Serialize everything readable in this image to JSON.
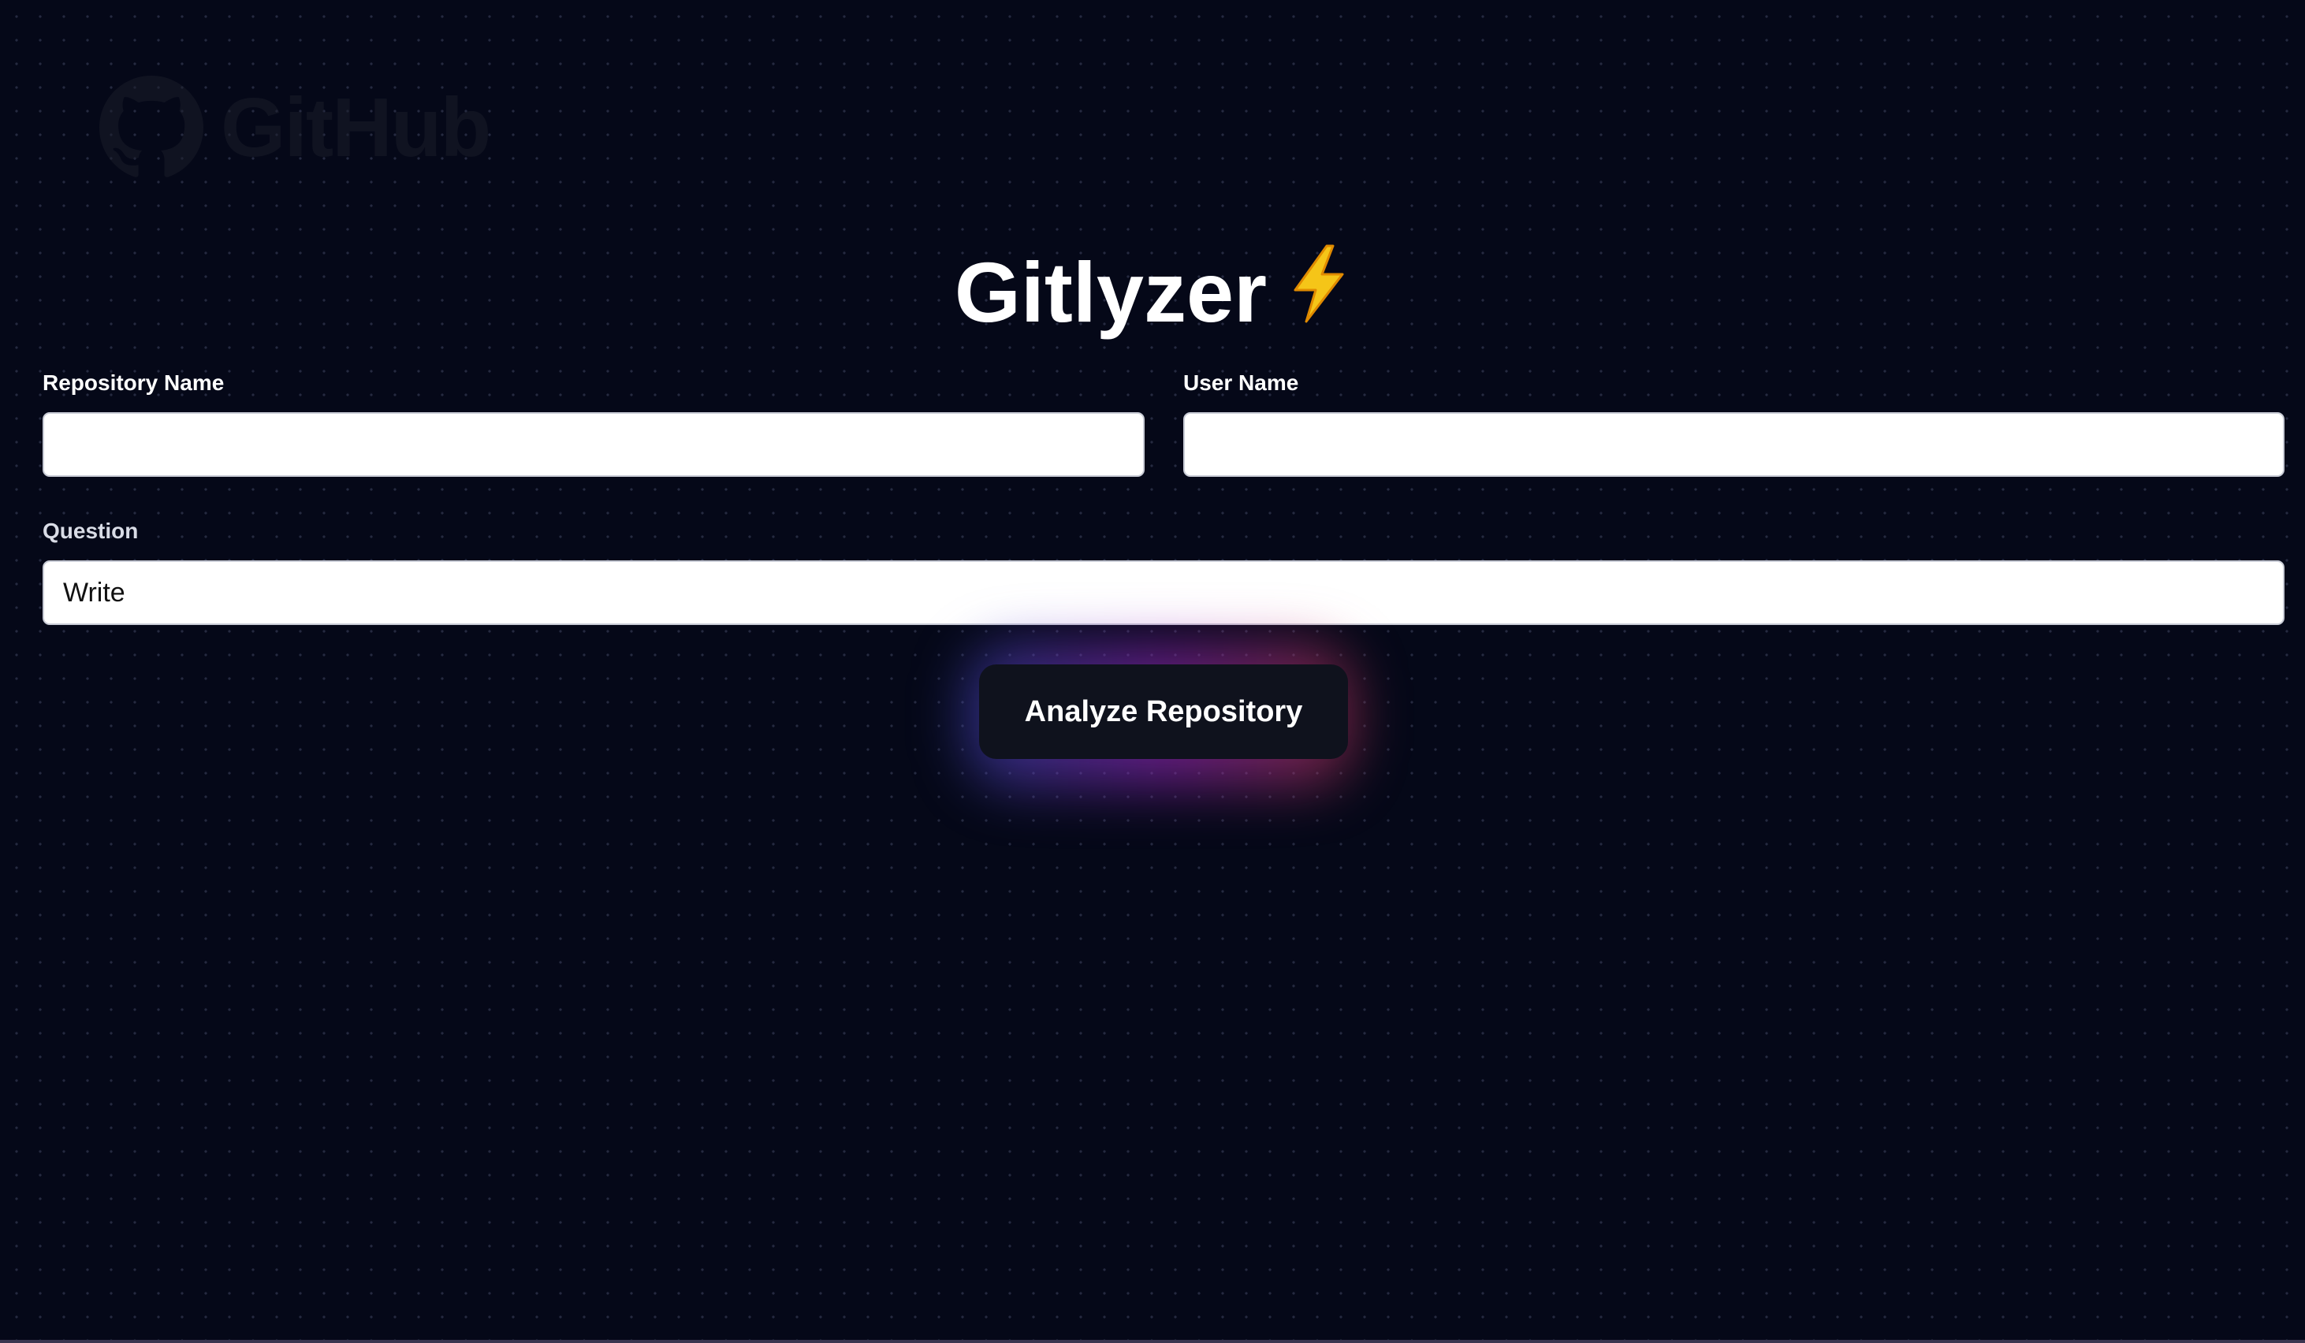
{
  "logo": {
    "icon": "github-octocat-icon",
    "wordmark": "GitHub"
  },
  "app": {
    "title": "Gitlyzer",
    "title_icon": "lightning-bolt-icon"
  },
  "form": {
    "repository_name": {
      "label": "Repository Name",
      "value": ""
    },
    "user_name": {
      "label": "User Name",
      "value": ""
    },
    "question": {
      "label": "Question",
      "value": "Write"
    },
    "submit_label": "Analyze Repository"
  },
  "colors": {
    "background": "#050818",
    "input_background": "#ffffff",
    "button_background": "#0f121d",
    "glow_start": "#4650d2",
    "glow_mid": "#9628be",
    "glow_end": "#d23c5a"
  }
}
